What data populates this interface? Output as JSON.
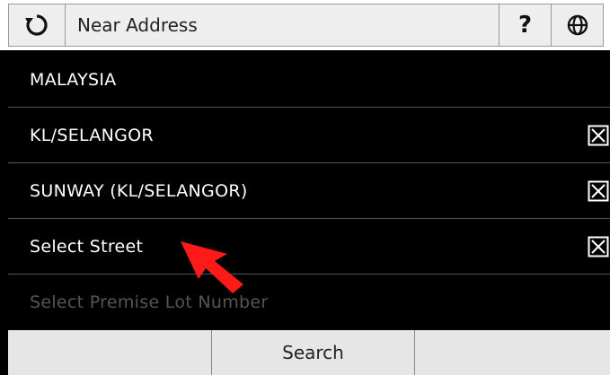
{
  "header": {
    "back_icon": "refresh-back-icon",
    "title": "Near Address",
    "help_label": "?",
    "globe_icon": "globe-icon"
  },
  "rows": [
    {
      "label": "MALAYSIA",
      "has_clear": false,
      "enabled": true
    },
    {
      "label": "KL/SELANGOR",
      "has_clear": true,
      "enabled": true
    },
    {
      "label": "SUNWAY (KL/SELANGOR)",
      "has_clear": true,
      "enabled": true
    },
    {
      "label": "Select Street",
      "has_clear": true,
      "enabled": true
    },
    {
      "label": "Select Premise Lot Number",
      "has_clear": false,
      "enabled": false
    }
  ],
  "bottom": {
    "left_label": "",
    "search_label": "Search",
    "right_label": ""
  },
  "colors": {
    "background": "#000000",
    "header_button": "#eeeeee",
    "bottom_bar": "#e6e6e6",
    "disabled_text": "#555555",
    "pointer_arrow": "#ff1a1a"
  }
}
